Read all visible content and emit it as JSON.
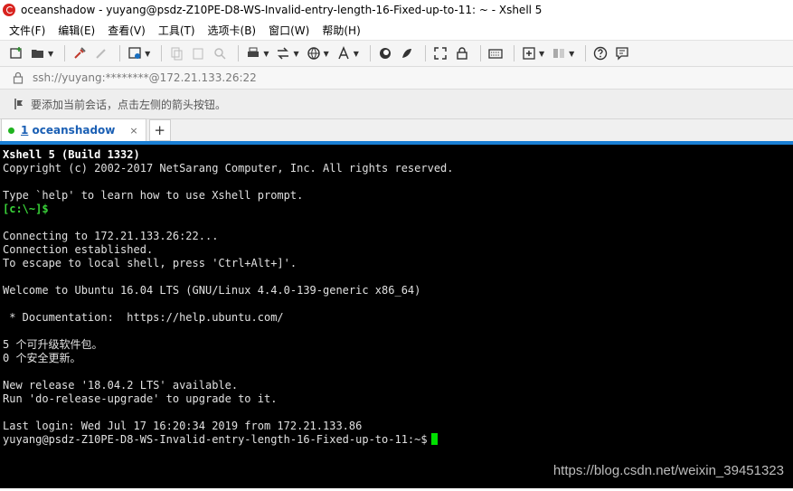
{
  "window": {
    "title": "oceanshadow - yuyang@psdz-Z10PE-D8-WS-Invalid-entry-length-16-Fixed-up-to-11: ~ - Xshell 5"
  },
  "menu": [
    "文件(F)",
    "编辑(E)",
    "查看(V)",
    "工具(T)",
    "选项卡(B)",
    "窗口(W)",
    "帮助(H)"
  ],
  "address": {
    "text": "ssh://yuyang:********@172.21.133.26:22"
  },
  "hint": {
    "text": "要添加当前会话，点击左侧的箭头按钮。"
  },
  "tabs": [
    {
      "number": "1",
      "label": "oceanshadow",
      "close": "×"
    }
  ],
  "tab_add": "+",
  "terminal": {
    "lines": [
      "Xshell 5 (Build 1332)",
      "Copyright (c) 2002-2017 NetSarang Computer, Inc. All rights reserved.",
      "",
      "Type `help' to learn how to use Xshell prompt.",
      "[c:\\~]$",
      "",
      "Connecting to 172.21.133.26:22...",
      "Connection established.",
      "To escape to local shell, press 'Ctrl+Alt+]'.",
      "",
      "Welcome to Ubuntu 16.04 LTS (GNU/Linux 4.4.0-139-generic x86_64)",
      "",
      " * Documentation:  https://help.ubuntu.com/",
      "",
      "5 个可升级软件包。",
      "0 个安全更新。",
      "",
      "New release '18.04.2 LTS' available.",
      "Run 'do-release-upgrade' to upgrade to it.",
      "",
      "Last login: Wed Jul 17 16:20:34 2019 from 172.21.133.86",
      "yuyang@psdz-Z10PE-D8-WS-Invalid-entry-length-16-Fixed-up-to-11:~$"
    ]
  },
  "watermark": "https://blog.csdn.net/weixin_39451323",
  "colors": {
    "terminal_bg": "#000000",
    "prompt_green": "#39d339",
    "cursor": "#00e000",
    "tab_accent": "#1a7fd4"
  },
  "icons": [
    "new-session-icon",
    "open-folder-icon",
    "connect-icon",
    "disconnect-icon",
    "properties-icon",
    "copy-icon",
    "paste-icon",
    "find-icon",
    "print-icon",
    "transfer-icon",
    "globe-icon",
    "font-icon",
    "xftp-icon",
    "script-icon",
    "fullscreen-icon",
    "lock-icon",
    "keyboard-icon",
    "add-icon",
    "layout-icon",
    "help-icon",
    "chat-icon"
  ]
}
